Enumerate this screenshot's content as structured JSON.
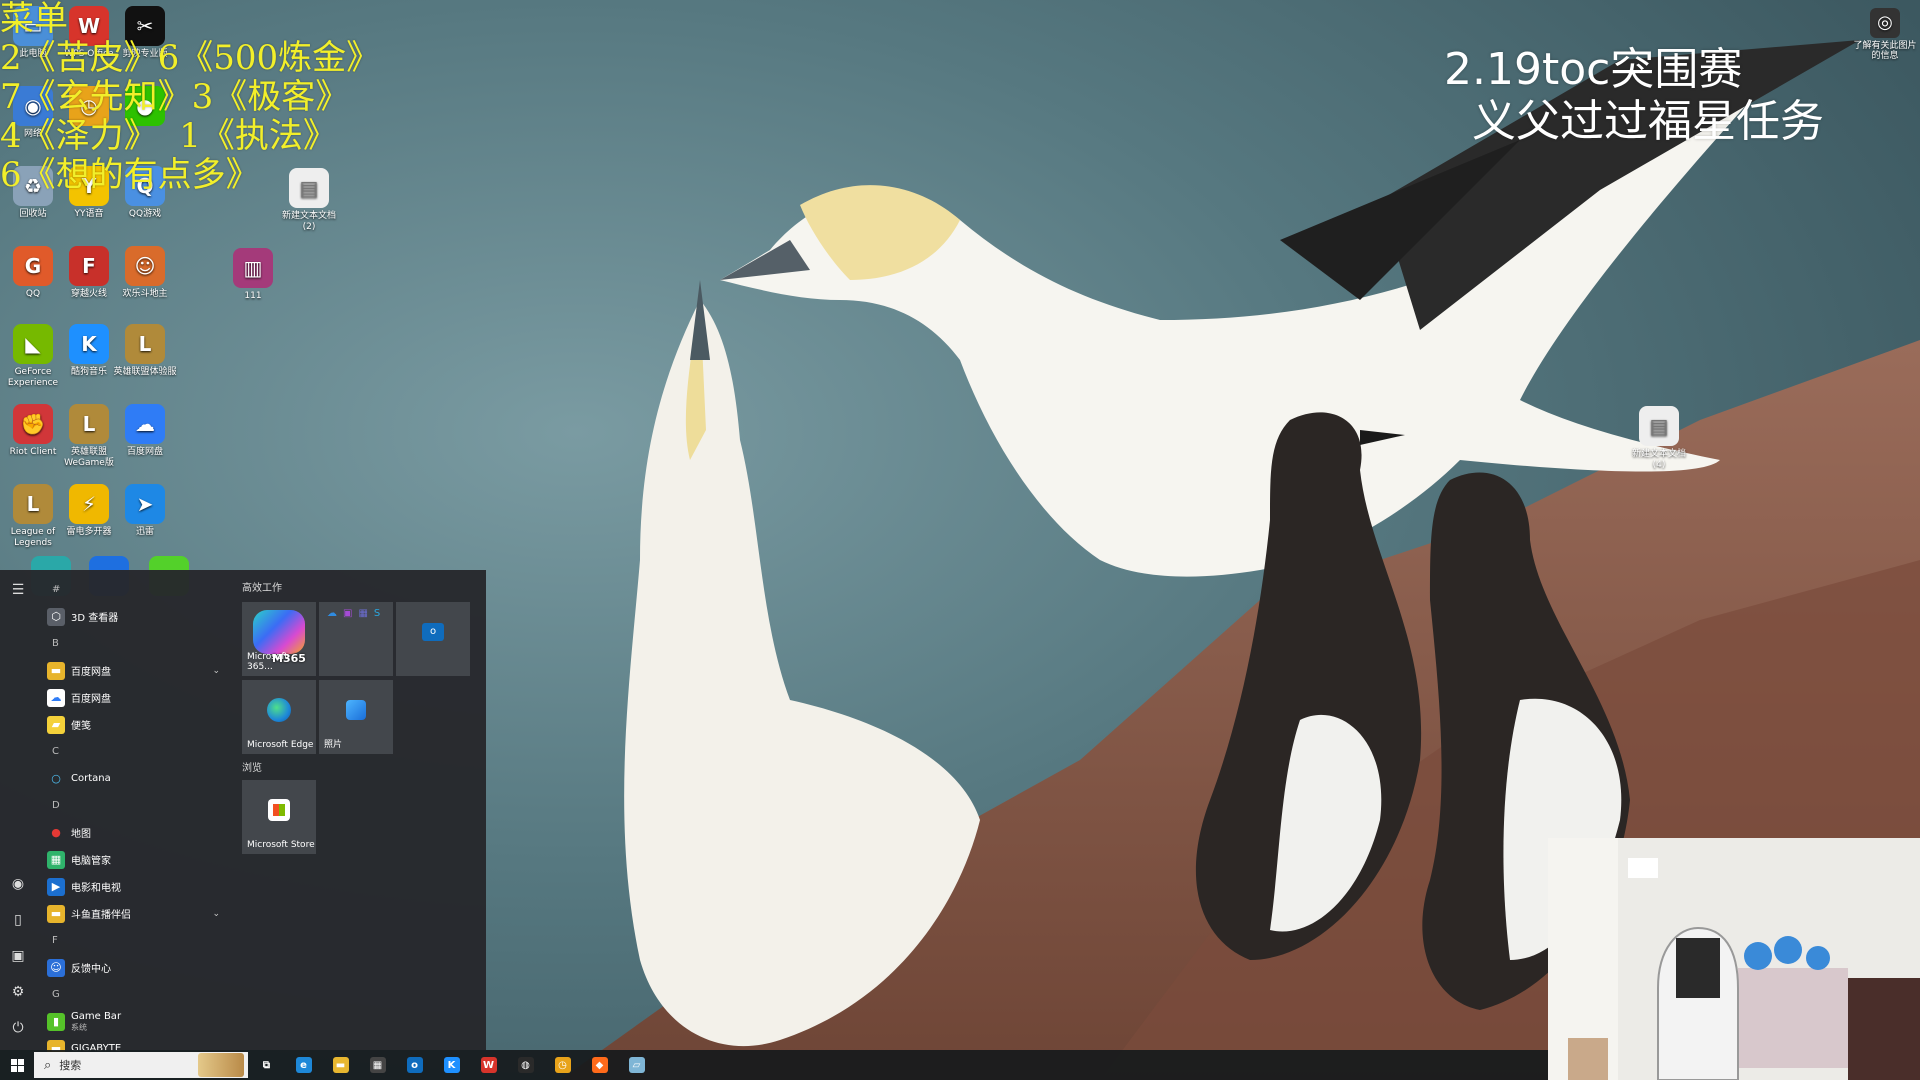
{
  "overlay": {
    "menu_lines": "菜单\n2《苦皮》6《500炼金》\n7《玄先知》3《极客》\n4《泽力》  1《执法》\n6《想的有点多》",
    "title_lines": "2.19toc突围赛\n  义父过过福星任务"
  },
  "desktop_icons": [
    {
      "label": "此电脑",
      "icon": "computer-icon",
      "color": "#4a8fd8",
      "glyph": "▭"
    },
    {
      "label": "WPS Office",
      "icon": "wps-icon",
      "color": "#d7342b",
      "glyph": "W"
    },
    {
      "label": "剪映专业版",
      "icon": "capcut-icon",
      "color": "#111111",
      "glyph": "✂"
    },
    {
      "label": "网络",
      "icon": "network-icon",
      "color": "#3a7bd5",
      "glyph": "◉"
    },
    {
      "label": "",
      "icon": "app-icon",
      "color": "#e8a31a",
      "glyph": "◷"
    },
    {
      "label": "",
      "icon": "wechat-icon",
      "color": "#2dc100",
      "glyph": "●"
    },
    {
      "label": "回收站",
      "icon": "recycle-bin-icon",
      "color": "#8aa2b8",
      "glyph": "♻"
    },
    {
      "label": "YY语音",
      "icon": "yy-icon",
      "color": "#f3c300",
      "glyph": "Y"
    },
    {
      "label": "QQ游戏",
      "icon": "qqgame-icon",
      "color": "#4a90e2",
      "glyph": "Q"
    },
    {
      "label": "新建文本文档 (2)",
      "icon": "text-file-icon",
      "color": "#eeeeee",
      "glyph": "▤"
    },
    {
      "label": "QQ",
      "icon": "qq-icon",
      "color": "#e05a2a",
      "glyph": "G"
    },
    {
      "label": "穿越火线",
      "icon": "cf-icon",
      "color": "#c8302a",
      "glyph": "F"
    },
    {
      "label": "欢乐斗地主",
      "icon": "doudizhu-icon",
      "color": "#d96b2b",
      "glyph": "☺"
    },
    {
      "label": "111",
      "icon": "archive-icon",
      "color": "#a43a7a",
      "glyph": "▥"
    },
    {
      "label": "GeForce Experience",
      "icon": "nvidia-icon",
      "color": "#76b900",
      "glyph": "◣"
    },
    {
      "label": "酷狗音乐",
      "icon": "kugou-icon",
      "color": "#1e90ff",
      "glyph": "K"
    },
    {
      "label": "英雄联盟体验服",
      "icon": "lol-pbe-icon",
      "color": "#b08a3a",
      "glyph": "L"
    },
    {
      "label": "Riot Client",
      "icon": "riot-icon",
      "color": "#d13639",
      "glyph": "✊"
    },
    {
      "label": "英雄联盟WeGame版",
      "icon": "lol-wegame-icon",
      "color": "#b08a3a",
      "glyph": "L"
    },
    {
      "label": "百度网盘",
      "icon": "baidu-netdisk-icon",
      "color": "#2f7cf6",
      "glyph": "☁"
    },
    {
      "label": "League of Legends",
      "icon": "lol-icon",
      "color": "#b08a3a",
      "glyph": "L"
    },
    {
      "label": "雷电多开器",
      "icon": "ldplayer-icon",
      "color": "#f0b800",
      "glyph": "⚡"
    },
    {
      "label": "迅雷",
      "icon": "xunlei-icon",
      "color": "#1e88e5",
      "glyph": "➤"
    },
    {
      "label": "新建文本文档 (4)",
      "icon": "text-file-icon",
      "color": "#eeeeee",
      "glyph": "▤"
    },
    {
      "label": "了解有关此图片的信息",
      "icon": "info-icon",
      "color": "#333333",
      "glyph": "◎"
    }
  ],
  "start_menu": {
    "rail_icons": [
      "menu-icon",
      "user-icon",
      "document-icon",
      "pictures-icon",
      "settings-icon",
      "power-icon"
    ],
    "apps": [
      {
        "type": "header",
        "text": "#"
      },
      {
        "type": "app",
        "text": "3D 查看器",
        "icon": "cube-icon",
        "color": "#5a5f68",
        "glyph": "⬡"
      },
      {
        "type": "header",
        "text": "B"
      },
      {
        "type": "app",
        "text": "百度网盘",
        "icon": "folder-icon",
        "color": "#e7b42c",
        "glyph": "▬",
        "chev": "⌄"
      },
      {
        "type": "app",
        "text": "百度网盘",
        "icon": "baidu-netdisk-icon",
        "color": "#ffffff",
        "glyph": "☁"
      },
      {
        "type": "app",
        "text": "便笺",
        "icon": "sticky-notes-icon",
        "color": "#f4d13a",
        "glyph": "▰"
      },
      {
        "type": "header",
        "text": "C"
      },
      {
        "type": "app",
        "text": "Cortana",
        "icon": "cortana-icon",
        "color": "transparent",
        "glyph": "○"
      },
      {
        "type": "header",
        "text": "D"
      },
      {
        "type": "app",
        "text": "地图",
        "icon": "maps-icon",
        "color": "transparent",
        "glyph": "●"
      },
      {
        "type": "app",
        "text": "电脑管家",
        "icon": "pc-manager-icon",
        "color": "#2fb36b",
        "glyph": "▦"
      },
      {
        "type": "app",
        "text": "电影和电视",
        "icon": "movies-icon",
        "color": "#1c6fcf",
        "glyph": "▶"
      },
      {
        "type": "app",
        "text": "斗鱼直播伴侣",
        "icon": "folder-icon",
        "color": "#e7b42c",
        "glyph": "▬",
        "chev": "⌄"
      },
      {
        "type": "header",
        "text": "F"
      },
      {
        "type": "app",
        "text": "反馈中心",
        "icon": "feedback-icon",
        "color": "#2b6fd8",
        "glyph": "☺"
      },
      {
        "type": "header",
        "text": "G"
      },
      {
        "type": "app",
        "text": "Game Bar",
        "sub": "系统",
        "icon": "gamebar-icon",
        "color": "#55c229",
        "glyph": "▮"
      },
      {
        "type": "app",
        "text": "GIGABYTE",
        "icon": "folder-icon",
        "color": "#e7b42c",
        "glyph": "▬"
      }
    ],
    "groups": [
      "高效工作",
      "浏览"
    ],
    "tiles": [
      "Microsoft 365...",
      "",
      "",
      "Microsoft Edge",
      "照片",
      "Microsoft Store"
    ],
    "m365_badge": "M365"
  },
  "taskbar": {
    "search_placeholder": "搜索",
    "icons": [
      {
        "name": "task-view-icon",
        "color": "transparent",
        "glyph": "⧉"
      },
      {
        "name": "edge-icon",
        "color": "#1e88d8",
        "glyph": "e"
      },
      {
        "name": "file-explorer-icon",
        "color": "#e8b730",
        "glyph": "▬"
      },
      {
        "name": "store-icon",
        "color": "#444",
        "glyph": "▦"
      },
      {
        "name": "outlook-icon",
        "color": "#0f6cbd",
        "glyph": "o"
      },
      {
        "name": "kugou-icon",
        "color": "#1e90ff",
        "glyph": "K"
      },
      {
        "name": "wps-icon",
        "color": "#d7342b",
        "glyph": "W"
      },
      {
        "name": "obs-icon",
        "color": "#2a2a2a",
        "glyph": "◍"
      },
      {
        "name": "app-icon",
        "color": "#e8a31a",
        "glyph": "◷"
      },
      {
        "name": "douyu-icon",
        "color": "#ff6a1a",
        "glyph": "◆"
      },
      {
        "name": "app2-icon",
        "color": "#7fb6d6",
        "glyph": "▱"
      }
    ]
  },
  "colors": {
    "menu_text": "#f2ef2a",
    "start_bg": "#26282c",
    "taskbar_bg": "#161a1c"
  }
}
